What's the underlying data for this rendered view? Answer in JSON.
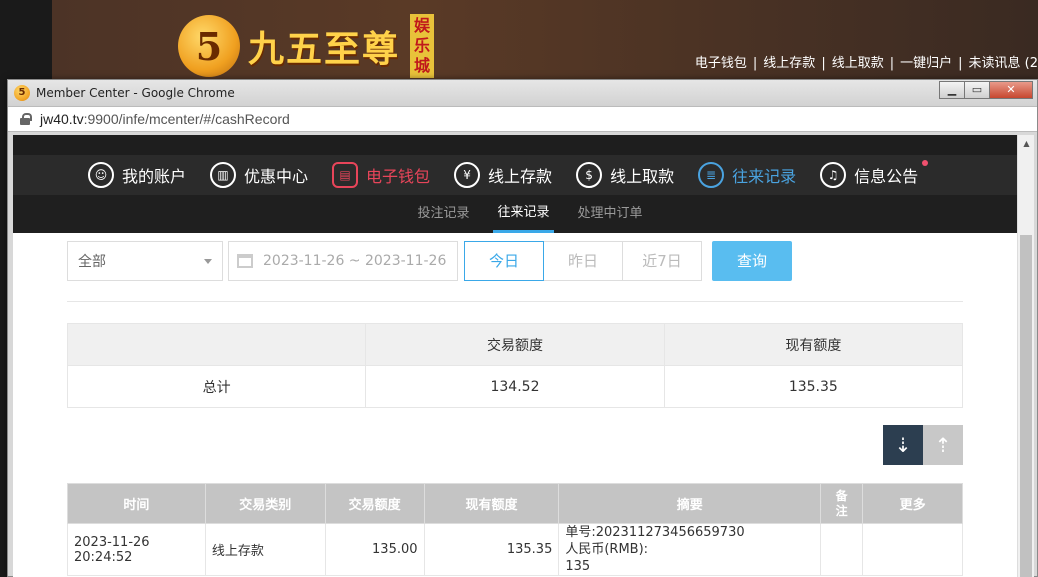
{
  "site": {
    "logo_text": "九五至尊",
    "logo_badge": "娱乐城",
    "top_links": [
      "电子钱包",
      "线上存款",
      "线上取款",
      "一键归户",
      "未读讯息 (2"
    ]
  },
  "window": {
    "title": "Member Center - Google Chrome",
    "url_host": "jw40.tv",
    "url_rest": ":9900/infe/mcenter/#/cashRecord"
  },
  "nav": {
    "items": [
      {
        "label": "我的账户",
        "icon": "user-icon"
      },
      {
        "label": "优惠中心",
        "icon": "gift-icon"
      },
      {
        "label": "电子钱包",
        "icon": "wallet-icon"
      },
      {
        "label": "线上存款",
        "icon": "deposit-icon"
      },
      {
        "label": "线上取款",
        "icon": "withdraw-icon"
      },
      {
        "label": "往来记录",
        "icon": "record-icon"
      },
      {
        "label": "信息公告",
        "icon": "bell-icon"
      }
    ],
    "sub_items": [
      "投注记录",
      "往来记录",
      "处理中订单"
    ]
  },
  "filters": {
    "type_value": "全部",
    "date_range": "2023-11-26 ~ 2023-11-26",
    "quick": [
      "今日",
      "昨日",
      "近7日"
    ],
    "search_label": "查询"
  },
  "summary": {
    "headers": [
      "",
      "交易额度",
      "现有额度"
    ],
    "row": [
      "总计",
      "134.52",
      "135.35"
    ]
  },
  "records": {
    "headers": [
      "时间",
      "交易类别",
      "交易额度",
      "现有额度",
      "摘要",
      "备注",
      "更多"
    ],
    "rows": [
      {
        "time": "2023-11-26 20:24:52",
        "type": "线上存款",
        "amount": "135.00",
        "balance": "135.35",
        "summary_line1": "单号:202311273456659730",
        "summary_line2": "人民币(RMB):",
        "summary_line3": "135",
        "note": "",
        "more": ""
      }
    ]
  },
  "colors": {
    "accent_blue": "#3aa8e8",
    "accent_red": "#e8455a",
    "nav_bg": "#2b2b2b"
  }
}
